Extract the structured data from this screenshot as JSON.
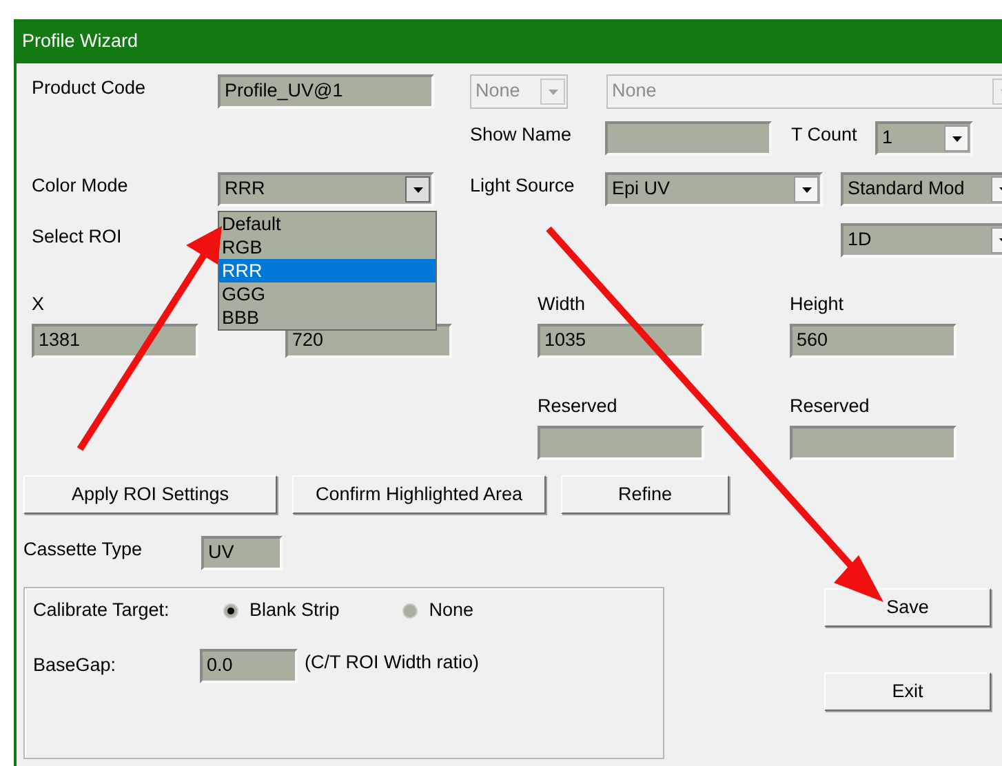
{
  "window": {
    "title": "Profile Wizard"
  },
  "product_code": {
    "label": "Product Code",
    "value": "Profile_UV@1"
  },
  "product_combo": {
    "value": "None",
    "disabled": true
  },
  "product_list": {
    "value": "None",
    "disabled": true
  },
  "show_name": {
    "label": "Show Name"
  },
  "t_count": {
    "label": "T Count",
    "value": "1"
  },
  "color_mode": {
    "label": "Color Mode",
    "value": "RRR",
    "expanded": true,
    "options": [
      {
        "label": "Default",
        "selected": false
      },
      {
        "label": "RGB",
        "selected": false
      },
      {
        "label": "RRR",
        "selected": true
      },
      {
        "label": "GGG",
        "selected": false
      },
      {
        "label": "BBB",
        "selected": false
      }
    ]
  },
  "light_source": {
    "label": "Light Source",
    "value": "Epi UV"
  },
  "mode": {
    "value": "Standard Mod"
  },
  "select_roi": {
    "label": "Select ROI",
    "value": "1D"
  },
  "roi_fields": [
    {
      "label": "X",
      "value": "1381"
    },
    {
      "value": "720"
    },
    {
      "label": "Width",
      "value": "1035"
    },
    {
      "label": "Height",
      "value": "560"
    }
  ],
  "reserved": [
    {
      "label": "Reserved"
    },
    {
      "label": "Reserved"
    }
  ],
  "roi_buttons": [
    "Apply ROI Settings",
    "Confirm Highlighted Area",
    "Refine"
  ],
  "cassette_type": {
    "label": "Cassette Type",
    "value": "UV"
  },
  "calibrate": {
    "label": "Calibrate Target:",
    "options": [
      {
        "label": "Blank Strip",
        "selected": true
      },
      {
        "label": "None",
        "selected": false
      }
    ]
  },
  "base_gap": {
    "label": "BaseGap:",
    "value": "0.0",
    "note": "(C/T ROI Width ratio)"
  },
  "buttons": [
    "Save",
    "Exit"
  ]
}
